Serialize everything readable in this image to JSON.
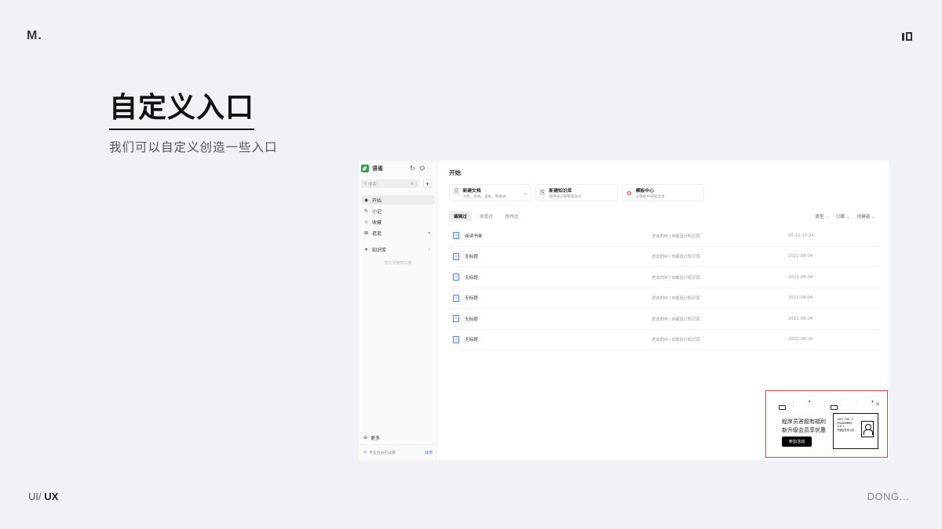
{
  "slide": {
    "logo": "M.",
    "heading": "自定义入口",
    "subheading": "我们可以自定义创造一些入口",
    "footer_left_light": "UI/ ",
    "footer_left_bold": "UX",
    "footer_right": "DONG..."
  },
  "app": {
    "brand": "语雀",
    "search_placeholder": "搜索",
    "search_shortcut": "⌘ J",
    "nav": [
      {
        "label": "开始"
      },
      {
        "label": "小记"
      },
      {
        "label": "收藏"
      },
      {
        "label": "逛逛"
      }
    ],
    "knowledge_base_label": "知识库",
    "knowledge_base_empty": "暂无常用知识库",
    "more_label": "更多",
    "membership_text": "专业会员已过期",
    "renew_label": "续费",
    "page_title": "开始",
    "quick_cards": [
      {
        "title": "新建文档",
        "desc": "文档、表格、画板、数据表"
      },
      {
        "title": "新建知识库",
        "desc": "使用知识库整理知识"
      },
      {
        "title": "模板中心",
        "desc": "从模板中获取灵感"
      }
    ],
    "tabs": [
      "编辑过",
      "浏览过",
      "协作过"
    ],
    "filters": [
      "类型",
      "归属",
      "创建者"
    ],
    "documents": [
      {
        "name": "阅读书单",
        "path": "进击的M / B端设计知识库",
        "time": "05-10 17:24",
        "kind": "sheet"
      },
      {
        "name": "无标题",
        "path": "进击的M / B端设计知识库",
        "time": "2021-08-04",
        "kind": "doc"
      },
      {
        "name": "无标题",
        "path": "进击的M / B端设计知识库",
        "time": "2021-08-04",
        "kind": "doc"
      },
      {
        "name": "无标题",
        "path": "进击的M / B端设计知识库",
        "time": "2021-08-04",
        "kind": "doc"
      },
      {
        "name": "无标题",
        "path": "进击的M / B端设计知识库",
        "time": "2021-08-04",
        "kind": "doc"
      },
      {
        "name": "无标题",
        "path": "进击的M / B端设计知识库",
        "time": "2021-08-04",
        "kind": "doc"
      }
    ],
    "promo": {
      "line1": "程序员答题有福利",
      "line2": "新升级会员享优惠",
      "button": "参加活动",
      "card_lines": [
        "JAVA  TOOL A",
        "PROGRAMMER",
        "JIN Y",
        "开通会员享七折"
      ]
    }
  },
  "colors": {
    "background": "#f0f2f5",
    "accent": "#4a7bf7",
    "brand_green": "#2ea44f",
    "highlight_border": "#d64545"
  }
}
